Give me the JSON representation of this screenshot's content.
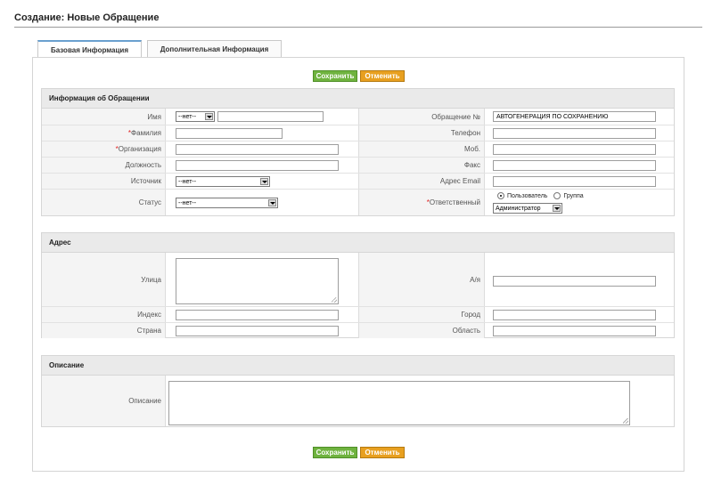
{
  "header": {
    "title": "Создание: Новые Обращение"
  },
  "tabs": [
    {
      "label": "Базовая Информация",
      "active": true
    },
    {
      "label": "Дополнительная Информация",
      "active": false
    }
  ],
  "actions": {
    "save": "Сохранить",
    "cancel": "Отменить"
  },
  "colors": {
    "save": "#6fb33f",
    "cancel": "#e8a020",
    "tab_accent": "#6aa0cf",
    "required": "#e02020"
  },
  "sections": {
    "info": {
      "title": "Информация об Обращении",
      "name_label": "Имя",
      "salutation": "--нет--",
      "lastname_label": "Фамилия",
      "org_label": "Организация",
      "position_label": "Должность",
      "source_label": "Источник",
      "source_value": "--нет--",
      "status_label": "Статус",
      "status_value": "--нет--",
      "number_label": "Обращение №",
      "number_value": "АВТОГЕНЕРАЦИЯ ПО СОХРАНЕНИЮ",
      "phone_label": "Телефон",
      "mobile_label": "Моб.",
      "fax_label": "Факс",
      "email_label": "Адрес Email",
      "assigned_label": "Ответственный",
      "assigned_user_opt": "Пользователь",
      "assigned_group_opt": "Группа",
      "assigned_value": "Администратор",
      "required_mark": "*"
    },
    "address": {
      "title": "Адрес",
      "street_label": "Улица",
      "pobox_label": "А/я",
      "zip_label": "Индекс",
      "city_label": "Город",
      "country_label": "Страна",
      "region_label": "Область"
    },
    "description": {
      "title": "Описание",
      "desc_label": "Описание"
    }
  }
}
